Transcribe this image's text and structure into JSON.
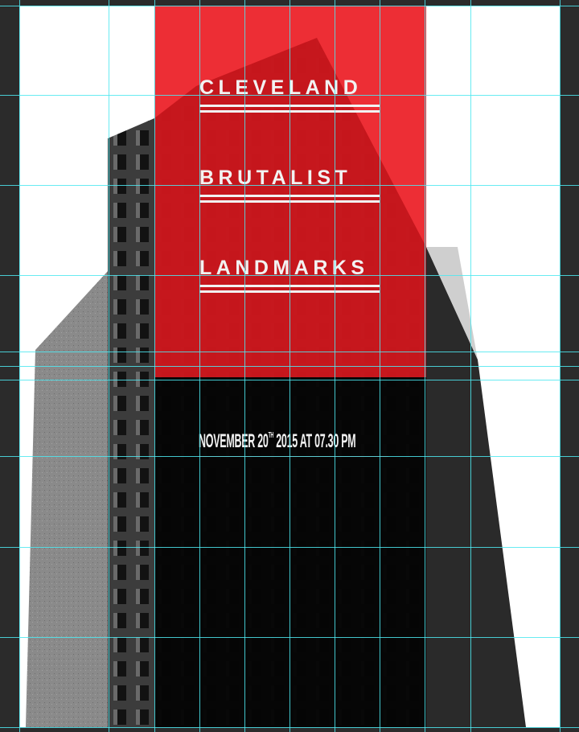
{
  "poster": {
    "title_line_1": "CLEVELAND",
    "title_line_2": "BRUTALIST",
    "title_line_3": "LANDMARKS",
    "date_part_1": "NOVEMBER 20",
    "date_superscript": "TH",
    "date_part_2": " 2015 AT 07.30 PM"
  },
  "colors": {
    "canvas_background": "#2b2b2b",
    "artboard": "#ffffff",
    "accent_red": "#ec1c24",
    "guide_cyan": "#4ee8f0",
    "text": "#f2f2f2"
  }
}
